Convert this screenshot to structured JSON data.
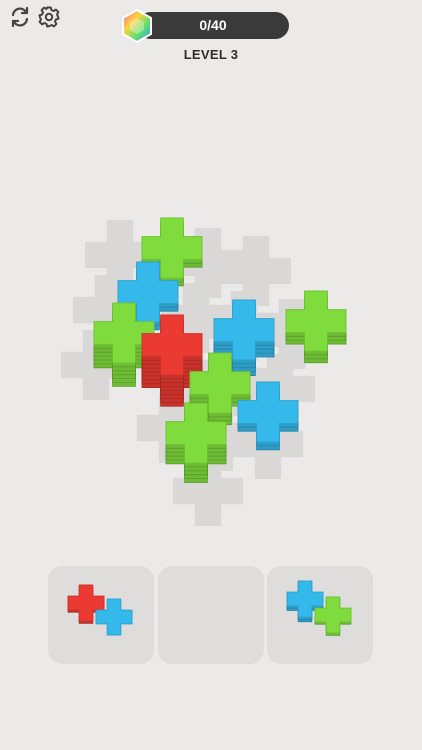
{
  "header": {
    "restart_icon": "refresh-icon",
    "settings_icon": "gear-icon",
    "gem_icon": "hexagon-gem-icon",
    "progress": {
      "current": 0,
      "total": 40,
      "label": "0/40",
      "fill_fraction": 0.0,
      "fill_color": "#f26a3a"
    },
    "level_label": "LEVEL 3"
  },
  "colors": {
    "green": "#7fdc3c",
    "blue": "#35b8ea",
    "red": "#ea3a32",
    "tile": "#d9d8d6"
  },
  "board": {
    "tiles": [
      {
        "col": 0,
        "row": 0
      },
      {
        "col": 1,
        "row": 0
      },
      {
        "col": 2,
        "row": 0
      },
      {
        "col": 0,
        "row": 1
      },
      {
        "col": 1,
        "row": 1
      },
      {
        "col": 2,
        "row": 1
      },
      {
        "col": 3,
        "row": 1
      },
      {
        "col": 0,
        "row": 2
      },
      {
        "col": 1,
        "row": 2
      },
      {
        "col": 2,
        "row": 2
      },
      {
        "col": 3,
        "row": 2
      },
      {
        "col": 1,
        "row": 3
      },
      {
        "col": 2,
        "row": 3
      },
      {
        "col": 3,
        "row": 3
      },
      {
        "col": 2,
        "row": 4
      }
    ],
    "stacks": [
      {
        "color": "green",
        "layers": 3,
        "col": 1,
        "row": 0
      },
      {
        "color": "blue",
        "layers": 3,
        "col": 1,
        "row": 1
      },
      {
        "color": "green",
        "layers": 7,
        "col": 0,
        "row": 2
      },
      {
        "color": "blue",
        "layers": 5,
        "col": 3,
        "row": 1
      },
      {
        "color": "green",
        "layers": 4,
        "col": 4,
        "row": 0
      },
      {
        "color": "red",
        "layers": 9,
        "col": 2,
        "row": 2
      },
      {
        "color": "green",
        "layers": 4,
        "col": 3,
        "row": 2
      },
      {
        "color": "blue",
        "layers": 3,
        "col": 4,
        "row": 2
      },
      {
        "color": "green",
        "layers": 6,
        "col": 3,
        "row": 3
      }
    ]
  },
  "tray": [
    {
      "pieces": [
        {
          "color": "red",
          "layers": 2
        },
        {
          "color": "blue",
          "layers": 1
        }
      ]
    },
    {
      "pieces": []
    },
    {
      "pieces": [
        {
          "color": "blue",
          "layers": 3
        },
        {
          "color": "green",
          "layers": 2
        }
      ]
    }
  ]
}
